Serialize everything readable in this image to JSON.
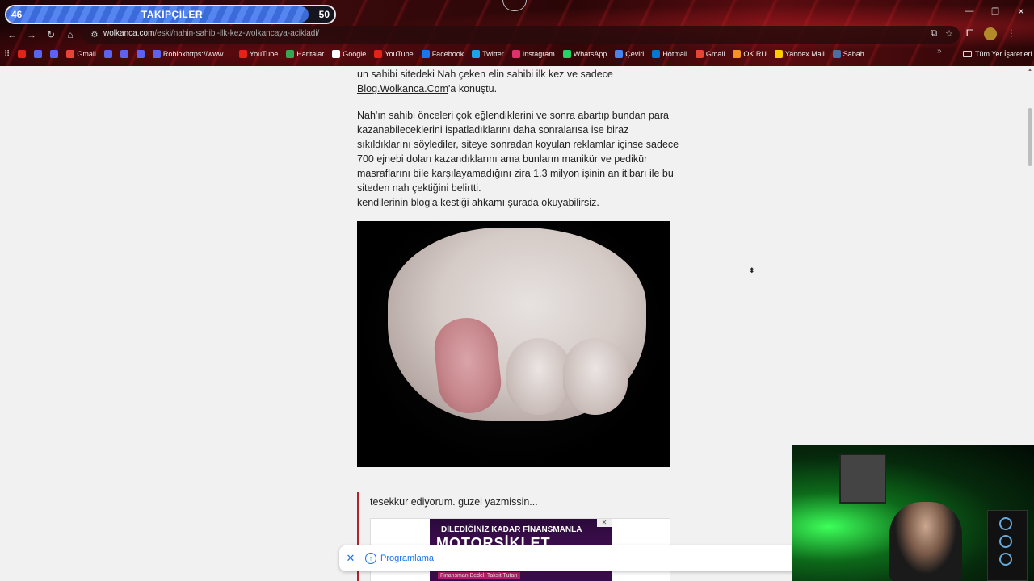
{
  "stream_overlay": {
    "current": "46",
    "label": "TAKİPÇİLER",
    "goal": "50",
    "progress": 0.92
  },
  "browser": {
    "url_domain": "wolkanca.com",
    "url_path": "/eski/nahin-sahibi-ilk-kez-wolkancaya-acikladi/",
    "bookmarks": [
      {
        "label": "",
        "color": "#e62117"
      },
      {
        "label": "",
        "color": "#5865f2"
      },
      {
        "label": "",
        "color": "#5865f2"
      },
      {
        "label": "Gmail",
        "color": "#ea4335"
      },
      {
        "label": "",
        "color": "#5865f2"
      },
      {
        "label": "",
        "color": "#5865f2"
      },
      {
        "label": "",
        "color": "#5865f2"
      },
      {
        "label": "Robloxhttps://www....",
        "color": "#5865f2"
      },
      {
        "label": "YouTube",
        "color": "#e62117"
      },
      {
        "label": "Haritalar",
        "color": "#34a853"
      },
      {
        "label": "Google",
        "color": "#ffffff"
      },
      {
        "label": "YouTube",
        "color": "#e62117"
      },
      {
        "label": "Facebook",
        "color": "#1877f2"
      },
      {
        "label": "Twitter",
        "color": "#1da1f2"
      },
      {
        "label": "Instagram",
        "color": "#e1306c"
      },
      {
        "label": "WhatsApp",
        "color": "#25d366"
      },
      {
        "label": "Çeviri",
        "color": "#4285f4"
      },
      {
        "label": "Hotmail",
        "color": "#0078d4"
      },
      {
        "label": "Gmail",
        "color": "#ea4335"
      },
      {
        "label": "OK.RU",
        "color": "#f7931e"
      },
      {
        "label": "Yandex.Mail",
        "color": "#ffcc00"
      },
      {
        "label": "Sabah",
        "color": "#4a6fa5"
      }
    ],
    "all_bookmarks": "Tüm Yer İşaretleri"
  },
  "article": {
    "p1_text": "un sahibi sitedeki Nah çeken elin sahibi ilk kez ve sadece",
    "p1_link": "Blog.Wolkanca.Com",
    "p1_tail": "'a konuştu.",
    "p2_text": "Nah'ın sahibi önceleri çok eğlendiklerini ve sonra abartıp bundan para kazanabileceklerini ispatladıklarını daha sonralarısa ise biraz sıkıldıklarını söylediler, siteye sonradan koyulan reklamlar içinse sadece 700 ejnebi doları kazandıklarını ama bunların manikür ve pedikür masraflarını bile karşılayamadığını zira 1.3 milyon işinin an itibarı ile bu siteden nah çektiğini belirtti.",
    "p3_text": "kendilerinin blog'a kestiği ahkamı",
    "p3_link": "şurada",
    "p3_tail": "okuyabilirsiz."
  },
  "comment": {
    "text": "tesekkur ediyorum. guzel yazmissin...",
    "ad_head": "DİLEDİĞİNİZ KADAR FİNANSMANLA",
    "ad_big": "MOTORSİKLET",
    "ad_foot": "Finansman Bedeli   Taksit Tutarı"
  },
  "notification": {
    "label": "Programlama"
  }
}
